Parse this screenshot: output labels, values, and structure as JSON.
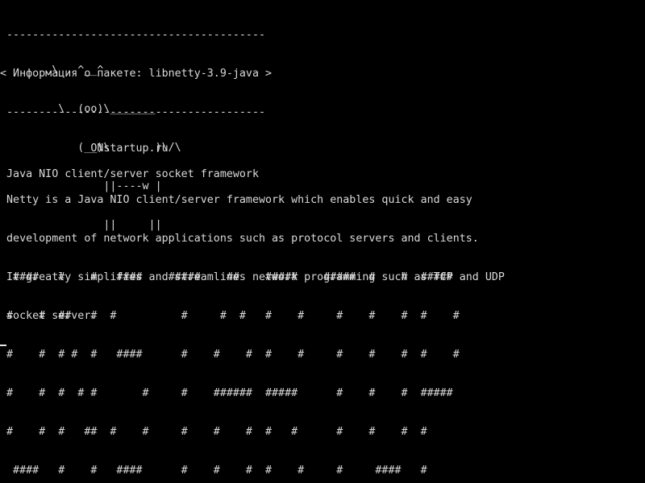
{
  "terminal": {
    "bubble": {
      "top_border": " ----------------------------------------",
      "text": "< Информация о пакете: libnetty-3.9-java >",
      "bottom_border": " ----------------------------------------"
    },
    "cow": [
      "        \\   ^__^",
      "         \\  (oo)\\_______",
      "            (__)\\       )\\/\\",
      "                ||----w |",
      "                ||     ||"
    ],
    "site": "              ONstartup.ru",
    "summary": " Java NIO client/server socket framework",
    "description": [
      " Netty is a Java NIO client/server framework which enables quick and easy",
      " development of network applications such as protocol servers and clients.",
      " It greatly simplifies and streamlines network programming such as TCP and UDP",
      " socket server."
    ],
    "banner": [
      "  ####   #    #   ####    #####    ##    #####    #####  #    #  #####",
      " #    #  ##   #  #          #     #  #   #    #     #    #    #  #    #",
      " #    #  # #  #   ####      #    #    #  #    #     #    #    #  #    #",
      " #    #  #  # #       #     #    ######  #####      #    #    #  #####",
      " #    #  #   ##  #    #     #    #    #  #   #      #    #    #  #",
      "  ####   #    #   ####      #    #    #  #    #     #     ####   #"
    ]
  }
}
